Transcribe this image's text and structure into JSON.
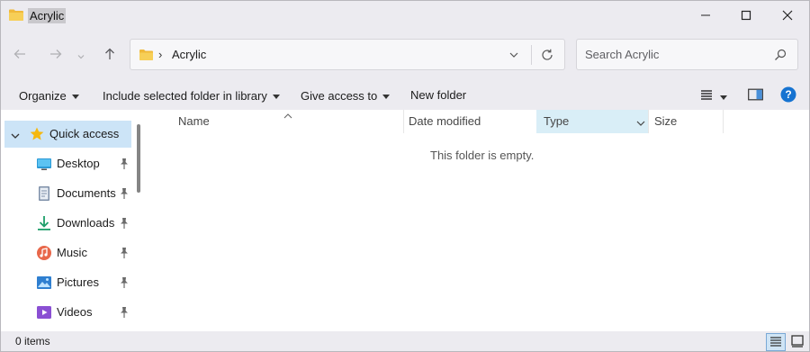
{
  "window": {
    "title": "Acrylic",
    "icon": "folder-icon",
    "controls": [
      "minimize-icon",
      "maximize-icon",
      "close-icon"
    ]
  },
  "navigation": {
    "back": "arrow-left-icon",
    "forward": "arrow-right-icon",
    "recent": "chevron-down-icon",
    "up": "arrow-up-icon"
  },
  "address": {
    "separator": "›",
    "path": "Acrylic"
  },
  "search": {
    "placeholder": "Search Acrylic"
  },
  "commandbar": {
    "organize": "Organize",
    "include": "Include selected folder in library",
    "share": "Give access to",
    "new_folder": "New folder"
  },
  "sidebar": {
    "items": [
      {
        "label": "Quick access",
        "icon": "star-icon"
      },
      {
        "label": "Desktop",
        "icon": "desktop-icon"
      },
      {
        "label": "Documents",
        "icon": "documents-icon"
      },
      {
        "label": "Downloads",
        "icon": "downloads-icon"
      },
      {
        "label": "Music",
        "icon": "music-icon"
      },
      {
        "label": "Pictures",
        "icon": "pictures-icon"
      },
      {
        "label": "Videos",
        "icon": "videos-icon"
      }
    ]
  },
  "filelist": {
    "columns": [
      "Name",
      "Date modified",
      "Type",
      "Size"
    ],
    "empty_message": "This folder is empty."
  },
  "status": {
    "item_count": "0 items"
  },
  "colors": {
    "window_bg": "#ecebf0",
    "selected_bg": "#cce4f7",
    "accent": "#0067c0",
    "folder": "#f2c34c"
  }
}
